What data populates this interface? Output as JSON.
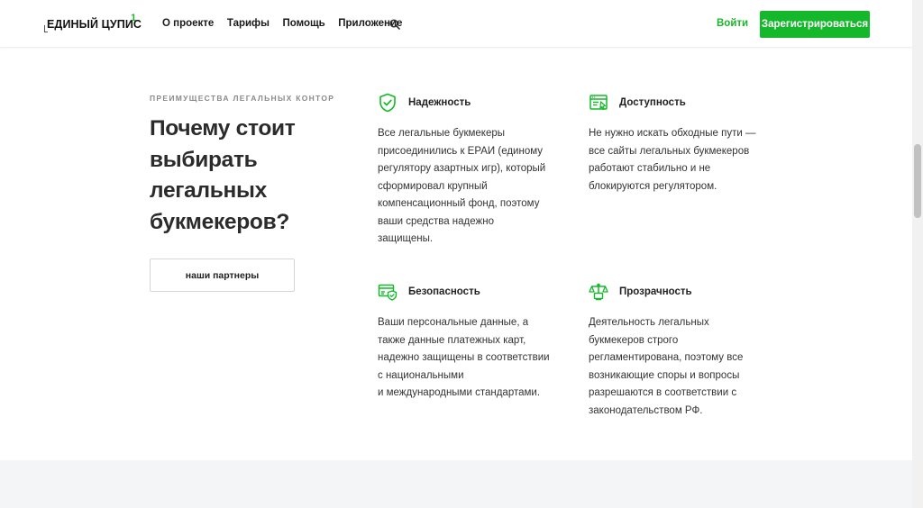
{
  "header": {
    "logo_text": "ЕДИНЫЙ ЦУПИС",
    "logo_sup": "1",
    "nav": [
      "О проекте",
      "Тарифы",
      "Помощь",
      "Приложение"
    ],
    "login": "Войти",
    "register": "Зарегистрироваться"
  },
  "section": {
    "eyebrow": "ПРЕИМУЩЕСТВА ЛЕГАЛЬНЫХ КОНТОР",
    "headline_lines": [
      "Почему стоит",
      "выбирать",
      "легальных",
      "букмекеров?"
    ],
    "partners_button": "наши партнеры"
  },
  "features": [
    {
      "icon": "shield-check-icon",
      "title": "Надежность",
      "lines": [
        "Все легальные букмекеры",
        "присоединились к ЕРАИ (единому",
        "регулятору азартных игр), который",
        "сформировал крупный",
        "компенсационный фонд, поэтому",
        "ваши средства надежно",
        "защищены."
      ]
    },
    {
      "icon": "browser-window-icon",
      "title": "Доступность",
      "lines": [
        "Не нужно искать обходные пути —",
        "все сайты легальных букмекеров",
        "работают стабильно и не",
        "блокируются регулятором."
      ]
    },
    {
      "icon": "card-shield-icon",
      "title": "Безопасность",
      "lines": [
        "Ваши персональные данные, а",
        "также данные платежных карт,",
        "надежно защищены в соответствии",
        "с национальными",
        "и международными стандартами."
      ]
    },
    {
      "icon": "scales-icon",
      "title": "Прозрачность",
      "lines": [
        "Деятельность легальных",
        "букмекеров строго",
        "регламентирована, поэтому все",
        "возникающие споры и вопросы",
        "разрешаются в соответствии с",
        "законодательством РФ."
      ]
    }
  ],
  "colors": {
    "accent": "#14b82a",
    "text": "#222222",
    "muted": "#8a8a8a",
    "footer_bg": "#f4f5f6"
  }
}
